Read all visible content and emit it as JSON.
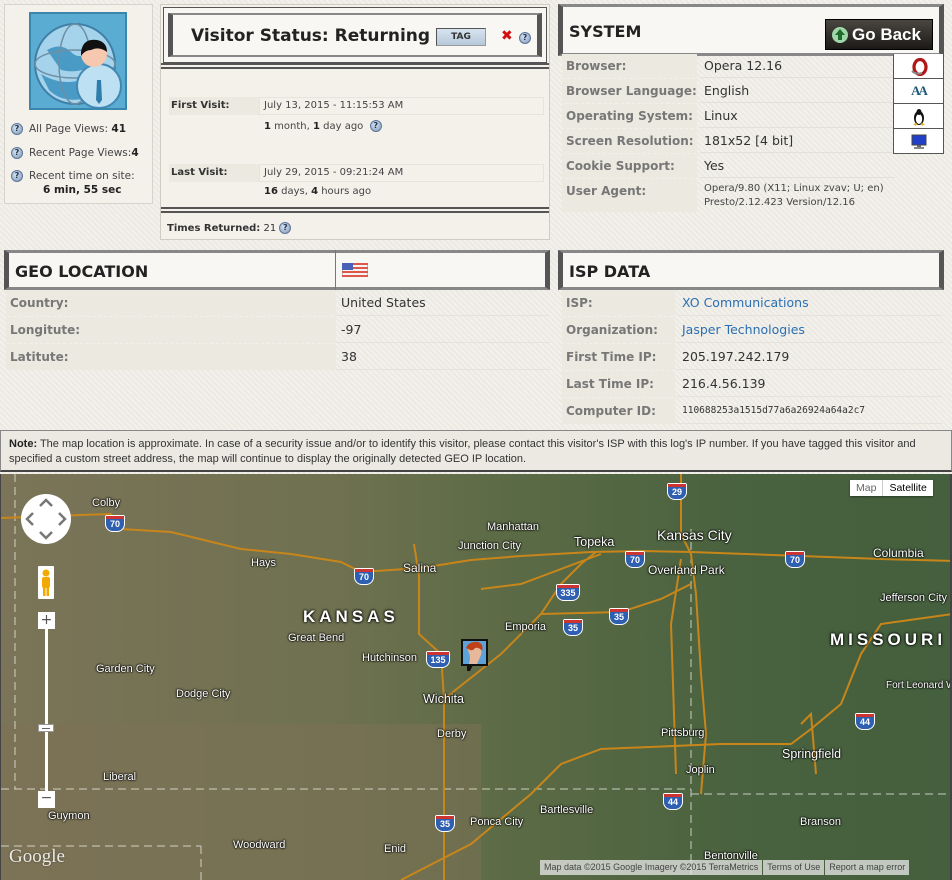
{
  "left_panel": {
    "all_page_views_label": "All Page Views:",
    "all_page_views": "41",
    "recent_page_views_label": "Recent Page Views:",
    "recent_page_views": "4",
    "recent_time_label": "Recent time on site:",
    "recent_time": "6 min, 55 sec"
  },
  "visitor": {
    "status_title": "Visitor Status: Returning",
    "tag_label": "TAG",
    "first_visit_label": "First Visit:",
    "first_visit_value": "July 13, 2015 - 11:15:53 AM",
    "first_visit_ago": {
      "n1": "1",
      "u1": " month, ",
      "n2": "1",
      "u2": " day ago"
    },
    "last_visit_label": "Last Visit:",
    "last_visit_value": "July 29, 2015 - 09:21:24 AM",
    "last_visit_ago": {
      "n1": "16",
      "u1": " days, ",
      "n2": "4",
      "u2": " hours ago"
    },
    "times_returned_label": "Times Returned:",
    "times_returned": "21"
  },
  "system": {
    "title": "SYSTEM",
    "go_back_label": "Go Back",
    "rows": [
      {
        "label": "Browser:",
        "value": "Opera 12.16",
        "icon": "opera-icon"
      },
      {
        "label": "Browser Language:",
        "value": "English",
        "icon": "font-icon"
      },
      {
        "label": "Operating System:",
        "value": "Linux",
        "icon": "linux-tux-icon"
      },
      {
        "label": "Screen Resolution:",
        "value": "181x52 [4 bit]",
        "icon": "monitor-icon"
      },
      {
        "label": "Cookie Support:",
        "value": "Yes"
      }
    ],
    "user_agent_label": "User Agent:",
    "user_agent_line1": "Opera/9.80 (X11; Linux zvav; U; en)",
    "user_agent_line2": "Presto/2.12.423 Version/12.16"
  },
  "geo": {
    "title": "GEO LOCATION",
    "flag": "us-flag-icon",
    "rows": [
      {
        "label": "Country:",
        "value": "United States"
      },
      {
        "label": "Longitute:",
        "value": "-97"
      },
      {
        "label": "Latitute:",
        "value": "38"
      }
    ]
  },
  "isp": {
    "title": "ISP DATA",
    "rows": [
      {
        "label": "ISP:",
        "value": "XO Communications"
      },
      {
        "label": "Organization:",
        "value": "Jasper Technologies"
      },
      {
        "label": "First Time IP:",
        "value": "205.197.242.179"
      },
      {
        "label": "Last Time IP:",
        "value": "216.4.56.139"
      },
      {
        "label": "Computer ID:",
        "value": "110688253a1515d77a6a26924a64a2c7"
      }
    ]
  },
  "note": {
    "label": "Note:",
    "text": " The map location is approximate. In case of a security issue and/or to identify this visitor, please contact this visitor's ISP with this log's IP number. If you have tagged this visitor and specified a custom street address, the map will continue to display the originally detected GEO IP location."
  },
  "map": {
    "type_map": "Map",
    "type_satellite": "Satellite",
    "selected_type": "Satellite",
    "google_logo": "Google",
    "attribution": "Map data ©2015 Google Imagery ©2015 TerraMetrics",
    "terms": "Terms of Use",
    "report": "Report a map error",
    "states": [
      "KANSAS",
      "MISSOURI"
    ],
    "cities": [
      "Colby",
      "Hays",
      "Manhattan",
      "Junction City",
      "Topeka",
      "Kansas City",
      "Overland Park",
      "Columbia",
      "Salina",
      "Jefferson City",
      "Great Bend",
      "Emporia",
      "Hutchinson",
      "Garden City",
      "Dodge City",
      "Wichita",
      "Fort Leonard Wood",
      "Derby",
      "Pittsburg",
      "Springfield",
      "Joplin",
      "Liberal",
      "Bartlesville",
      "Guymon",
      "Ponca City",
      "Branson",
      "Woodward",
      "Enid",
      "Bentonville"
    ],
    "highways": [
      "70",
      "70",
      "70",
      "70",
      "29",
      "335",
      "35",
      "35",
      "135",
      "44",
      "44",
      "35"
    ]
  }
}
